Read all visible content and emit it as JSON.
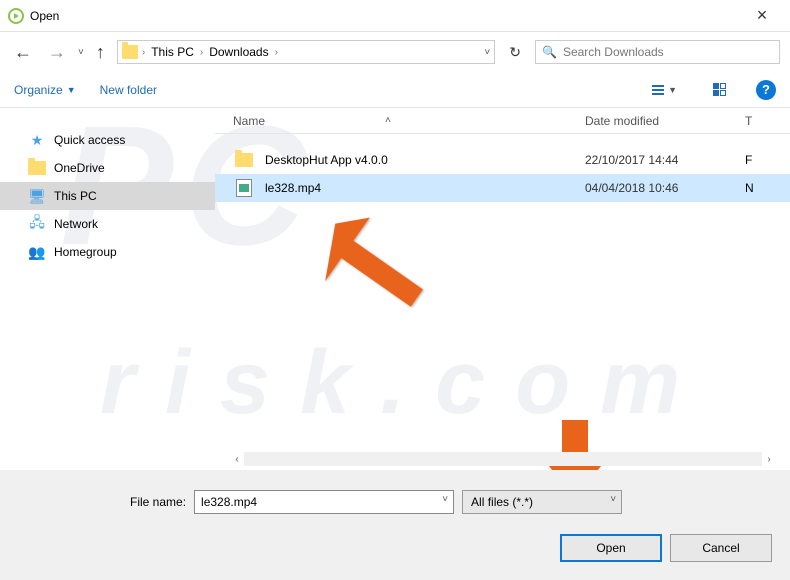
{
  "titlebar": {
    "title": "Open"
  },
  "breadcrumb": {
    "items": [
      "This PC",
      "Downloads"
    ]
  },
  "search": {
    "placeholder": "Search Downloads"
  },
  "toolbar": {
    "organize": "Organize",
    "new_folder": "New folder"
  },
  "sidebar": {
    "items": [
      {
        "label": "Quick access"
      },
      {
        "label": "OneDrive"
      },
      {
        "label": "This PC"
      },
      {
        "label": "Network"
      },
      {
        "label": "Homegroup"
      }
    ]
  },
  "columns": {
    "name": "Name",
    "date": "Date modified",
    "type": "T"
  },
  "files": [
    {
      "name": "DesktopHut App v4.0.0",
      "date": "22/10/2017 14:44",
      "type": "F",
      "kind": "folder",
      "selected": false
    },
    {
      "name": "le328.mp4",
      "date": "04/04/2018 10:46",
      "type": "N",
      "kind": "video",
      "selected": true
    }
  ],
  "bottom": {
    "filename_label": "File name:",
    "filename_value": "le328.mp4",
    "filter_label": "All files (*.*)",
    "open_label": "Open",
    "cancel_label": "Cancel"
  },
  "watermark": {
    "big": "PC",
    "small": "risk.com"
  }
}
